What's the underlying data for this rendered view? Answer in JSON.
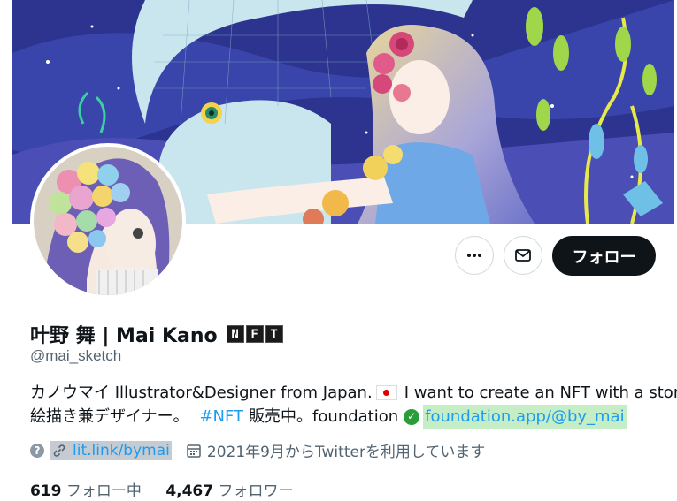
{
  "profile": {
    "display_name": "叶野 舞 | Mai Kano",
    "nft_letters": [
      "N",
      "F",
      "T"
    ],
    "handle": "@mai_sketch",
    "bio_line1_a": "カノウマイ Illustrator&Designer from Japan.",
    "bio_line1_b": "I want to create an NFT with a story.",
    "bio_line2_a": "絵描き兼デザイナー。",
    "bio_hashtag": "#NFT",
    "bio_line2_b": "販売中。foundation",
    "bio_link": "foundation.app/@by_mai",
    "website": "lit.link/bymai",
    "joined": "2021年9月からTwitterを利用しています",
    "following_count": "619",
    "following_label": "フォロー中",
    "followers_count": "4,467",
    "followers_label": "フォロワー"
  },
  "actions": {
    "follow_label": "フォロー",
    "more_icon": "more-icon",
    "message_icon": "mail-icon"
  },
  "colors": {
    "accent": "#1d9bf0",
    "follow_bg": "#0f1419",
    "highlight": "#c6eec6",
    "banner_sky": "#2f3a8f"
  }
}
